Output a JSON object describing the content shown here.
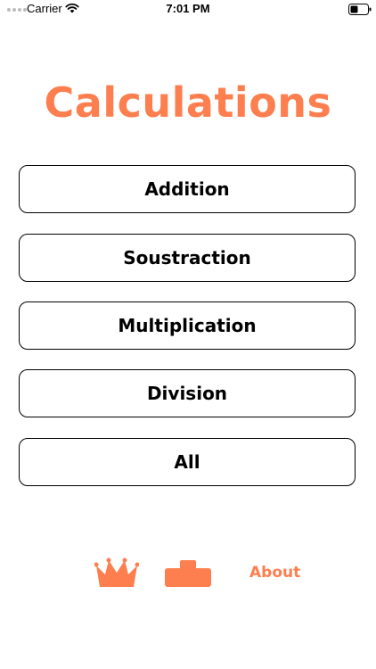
{
  "status_bar": {
    "carrier": "Carrier",
    "time": "7:01 PM"
  },
  "title": "Calculations",
  "menu": {
    "items": [
      {
        "label": "Addition"
      },
      {
        "label": "Soustraction"
      },
      {
        "label": "Multiplication"
      },
      {
        "label": "Division"
      },
      {
        "label": "All"
      }
    ]
  },
  "bottom_bar": {
    "crown_icon": "crown-icon",
    "podium_icon": "podium-icon",
    "about_label": "About"
  },
  "colors": {
    "accent": "#fd7e4e",
    "text": "#000000",
    "background": "#ffffff"
  }
}
